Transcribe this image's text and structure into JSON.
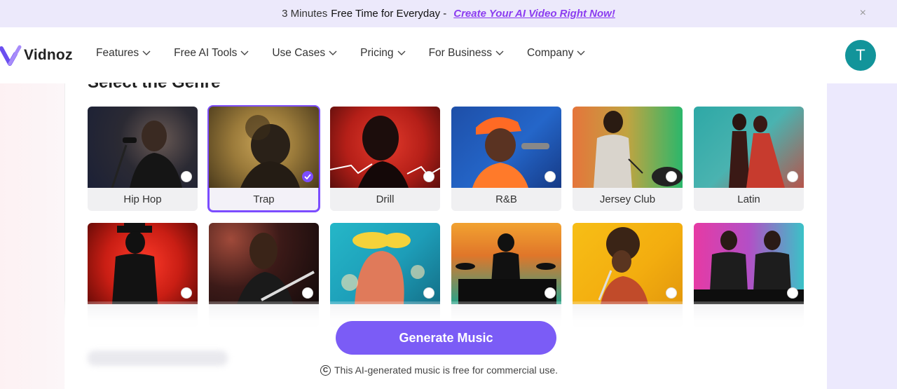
{
  "banner": {
    "prefix": "3 Minutes",
    "highlight": "Free Time for Everyday -",
    "link": "Create Your AI Video Right Now!",
    "close_icon": "×"
  },
  "nav": {
    "logo": "Vidnoz",
    "items": [
      {
        "label": "Features"
      },
      {
        "label": "Free AI Tools"
      },
      {
        "label": "Use Cases"
      },
      {
        "label": "Pricing"
      },
      {
        "label": "For Business"
      },
      {
        "label": "Company"
      }
    ],
    "avatar_initial": "T"
  },
  "section": {
    "title": "Select the Genre"
  },
  "genres_row1": [
    {
      "label": "Hip Hop",
      "selected": false
    },
    {
      "label": "Trap",
      "selected": true
    },
    {
      "label": "Drill",
      "selected": false
    },
    {
      "label": "R&B",
      "selected": false
    },
    {
      "label": "Jersey Club",
      "selected": false
    },
    {
      "label": "Latin",
      "selected": false
    }
  ],
  "generate": {
    "button_label": "Generate Music",
    "note": "This AI-generated music is free for commercial use."
  },
  "colors": {
    "accent": "#7b5cf6",
    "avatar": "#12949a",
    "link": "#8b3cf0"
  }
}
